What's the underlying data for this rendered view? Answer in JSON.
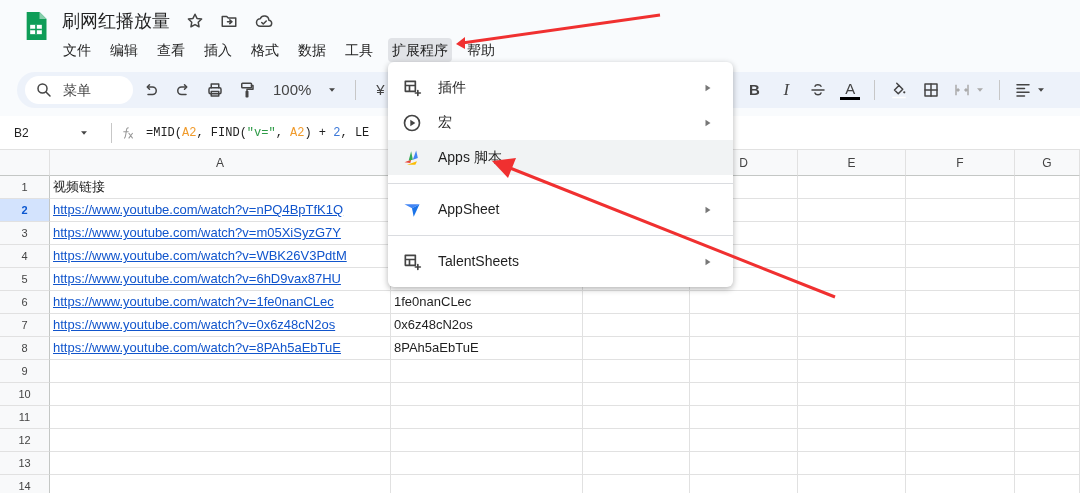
{
  "app": {
    "title": "刷网红播放量"
  },
  "menubar": [
    {
      "label": "文件",
      "selected": false
    },
    {
      "label": "编辑",
      "selected": false
    },
    {
      "label": "查看",
      "selected": false
    },
    {
      "label": "插入",
      "selected": false
    },
    {
      "label": "格式",
      "selected": false
    },
    {
      "label": "数据",
      "selected": false
    },
    {
      "label": "工具",
      "selected": false
    },
    {
      "label": "扩展程序",
      "selected": true
    },
    {
      "label": "帮助",
      "selected": false
    }
  ],
  "toolbar": {
    "search": {
      "placeholder": "菜单"
    },
    "zoom": "100%",
    "currency": "¥",
    "bold": "B",
    "italic": "I",
    "text_color": "A"
  },
  "formula_bar": {
    "cell_ref": "B2",
    "formula": [
      {
        "kind": "plain",
        "text": "=MID("
      },
      {
        "kind": "ref",
        "text": "A2"
      },
      {
        "kind": "plain",
        "text": ", FIND("
      },
      {
        "kind": "string",
        "text": "\"v=\""
      },
      {
        "kind": "plain",
        "text": ", "
      },
      {
        "kind": "ref",
        "text": "A2"
      },
      {
        "kind": "plain",
        "text": ") + "
      },
      {
        "kind": "number",
        "text": "2"
      },
      {
        "kind": "plain",
        "text": ", LE"
      }
    ]
  },
  "sheet": {
    "columns": [
      {
        "label": "A"
      },
      {},
      {},
      {
        "label": "D"
      },
      {
        "label": "E"
      },
      {
        "label": "F"
      },
      {
        "label": "G"
      }
    ],
    "rows": [
      {
        "number": "1",
        "selected": false,
        "a": {
          "text": "视频链接",
          "link": false
        }
      },
      {
        "number": "2",
        "selected": true,
        "a": {
          "text": "https://www.youtube.com/watch?v=nPQ4BpTfK1Q",
          "link": true
        }
      },
      {
        "number": "3",
        "selected": false,
        "a": {
          "text": "https://www.youtube.com/watch?v=m05XiSyzG7Y",
          "link": true
        }
      },
      {
        "number": "4",
        "selected": false,
        "a": {
          "text": "https://www.youtube.com/watch?v=WBK26V3PdtM",
          "link": true
        }
      },
      {
        "number": "5",
        "selected": false,
        "a": {
          "text": "https://www.youtube.com/watch?v=6hD9vax87HU",
          "link": true
        }
      },
      {
        "number": "6",
        "selected": false,
        "a": {
          "text": "https://www.youtube.com/watch?v=1fe0nanCLec",
          "link": true
        },
        "b": "1fe0nanCLec"
      },
      {
        "number": "7",
        "selected": false,
        "a": {
          "text": "https://www.youtube.com/watch?v=0x6z48cN2os",
          "link": true
        },
        "b": "0x6z48cN2os"
      },
      {
        "number": "8",
        "selected": false,
        "a": {
          "text": "https://www.youtube.com/watch?v=8PAh5aEbTuE",
          "link": true
        },
        "b": "8PAh5aEbTuE"
      },
      {
        "number": "9",
        "selected": false
      },
      {
        "number": "10",
        "selected": false
      },
      {
        "number": "11",
        "selected": false
      },
      {
        "number": "12",
        "selected": false
      },
      {
        "number": "13",
        "selected": false
      },
      {
        "number": "14",
        "selected": false
      }
    ]
  },
  "extensions_menu": [
    [
      {
        "label": "插件",
        "kind": "addon",
        "submenu": true,
        "selected": false
      },
      {
        "label": "宏",
        "kind": "macro",
        "submenu": true,
        "selected": false
      },
      {
        "label": "Apps 脚本",
        "kind": "script",
        "submenu": false,
        "selected": true
      }
    ],
    [
      {
        "label": "AppSheet",
        "kind": "appsheet",
        "submenu": true,
        "selected": false
      }
    ],
    [
      {
        "label": "TalentSheets",
        "kind": "addon",
        "submenu": true,
        "selected": false
      }
    ]
  ]
}
